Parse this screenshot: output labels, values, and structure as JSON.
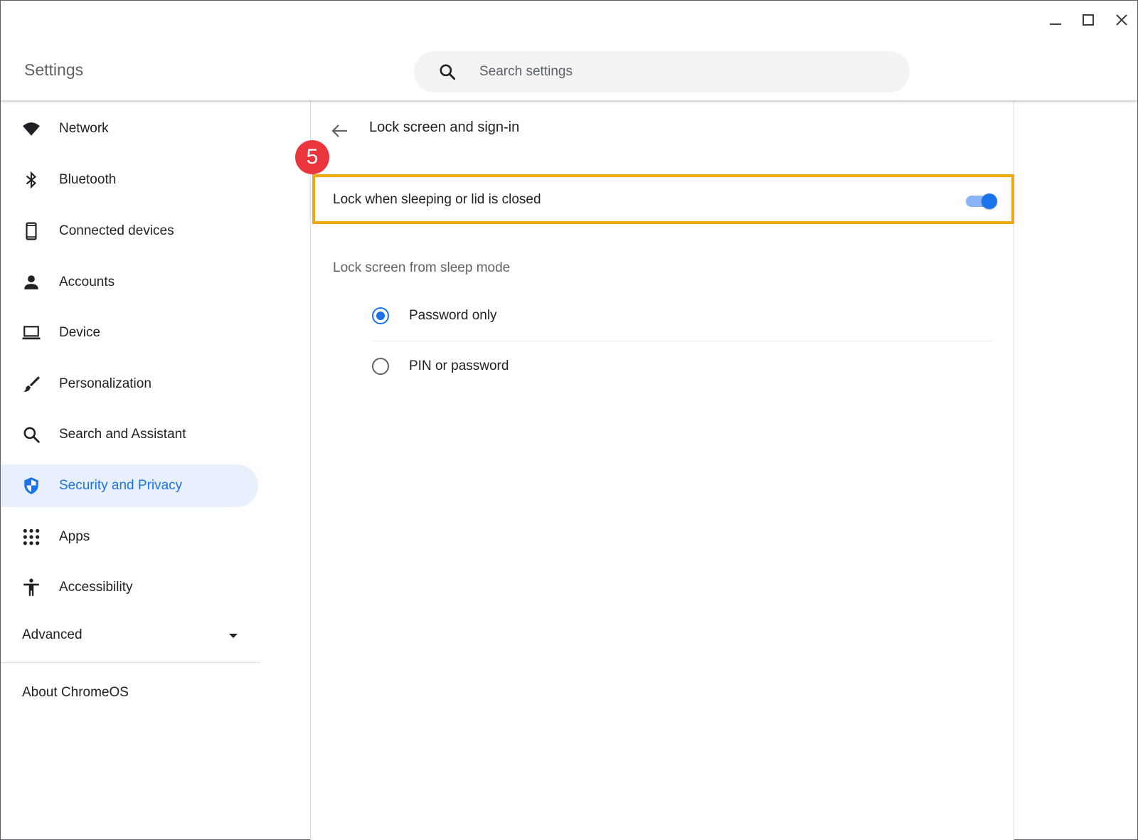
{
  "app": {
    "title": "Settings"
  },
  "search": {
    "placeholder": "Search settings"
  },
  "sidebar": {
    "items": [
      {
        "label": "Network",
        "icon": "wifi-icon"
      },
      {
        "label": "Bluetooth",
        "icon": "bluetooth-icon"
      },
      {
        "label": "Connected devices",
        "icon": "phone-icon"
      },
      {
        "label": "Accounts",
        "icon": "person-icon"
      },
      {
        "label": "Device",
        "icon": "laptop-icon"
      },
      {
        "label": "Personalization",
        "icon": "brush-icon"
      },
      {
        "label": "Search and Assistant",
        "icon": "search-icon"
      },
      {
        "label": "Security and Privacy",
        "icon": "shield-icon",
        "active": true
      },
      {
        "label": "Apps",
        "icon": "apps-grid-icon"
      },
      {
        "label": "Accessibility",
        "icon": "accessibility-icon"
      }
    ],
    "advanced_label": "Advanced",
    "about_label": "About ChromeOS"
  },
  "main": {
    "page_title": "Lock screen and sign-in",
    "step_badge": "5",
    "lock_toggle": {
      "label": "Lock when sleeping or lid is closed",
      "enabled": true
    },
    "sleep_section_label": "Lock screen from sleep mode",
    "options": [
      {
        "label": "Password only",
        "selected": true
      },
      {
        "label": "PIN or password",
        "selected": false
      }
    ]
  },
  "colors": {
    "accent": "#1a73e8",
    "active_bg": "#e8f0fe",
    "highlight_border": "#f4a80c",
    "badge": "#e9353b"
  }
}
